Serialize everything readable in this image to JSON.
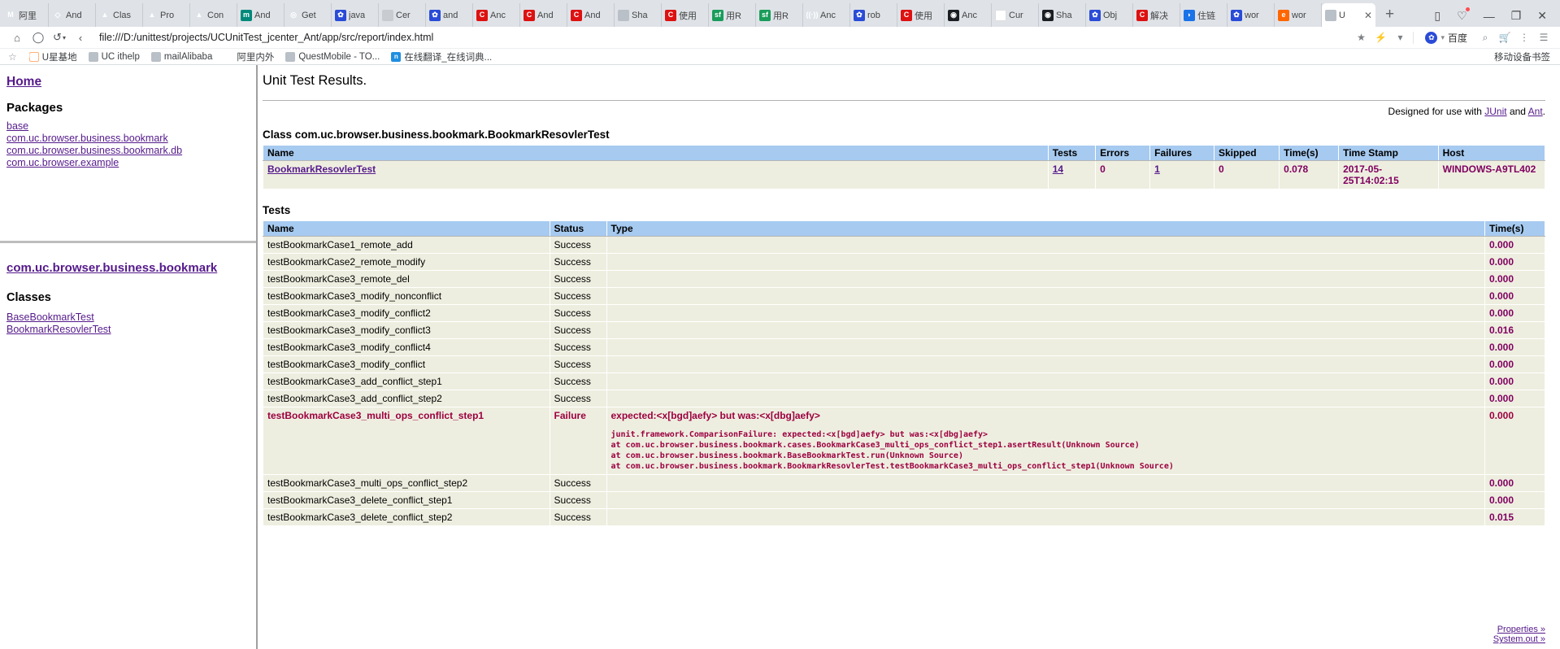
{
  "browser": {
    "tabs": [
      {
        "label": "阿里",
        "icon": "m-logo-icon",
        "style": "fav-m",
        "glyph": "M"
      },
      {
        "label": "And",
        "icon": "code-icon",
        "style": "fav-android",
        "glyph": "◇"
      },
      {
        "label": "Clas",
        "icon": "android-icon",
        "style": "fav-android",
        "glyph": "▲"
      },
      {
        "label": "Pro",
        "icon": "android-icon",
        "style": "fav-android",
        "glyph": "▲"
      },
      {
        "label": "Con",
        "icon": "android-icon",
        "style": "fav-android",
        "glyph": "▲"
      },
      {
        "label": "And",
        "icon": "maven-icon",
        "style": "fav-teal",
        "glyph": "m"
      },
      {
        "label": "Get",
        "icon": "gradle-icon",
        "style": "fav-get",
        "glyph": "◎"
      },
      {
        "label": "java",
        "icon": "baidu-paw-icon",
        "style": "fav-baidu",
        "glyph": "✿"
      },
      {
        "label": "Cer",
        "icon": "blank-page-icon",
        "style": "fav-plain",
        "glyph": ""
      },
      {
        "label": "and",
        "icon": "baidu-paw-icon",
        "style": "fav-baidu",
        "glyph": "✿"
      },
      {
        "label": "Anc",
        "icon": "csdn-icon",
        "style": "fav-c",
        "glyph": "C"
      },
      {
        "label": "And",
        "icon": "csdn-icon",
        "style": "fav-c",
        "glyph": "C"
      },
      {
        "label": "And",
        "icon": "csdn-icon",
        "style": "fav-c",
        "glyph": "C"
      },
      {
        "label": "Sha",
        "icon": "document-icon",
        "style": "fav-doc",
        "glyph": ""
      },
      {
        "label": "使用",
        "icon": "csdn-icon",
        "style": "fav-c",
        "glyph": "C"
      },
      {
        "label": "用R",
        "icon": "sf-icon",
        "style": "fav-sf",
        "glyph": "sf"
      },
      {
        "label": "用R",
        "icon": "sf-icon",
        "style": "fav-sf",
        "glyph": "sf"
      },
      {
        "label": "Anc",
        "icon": "wifi-icon",
        "style": "fav-wifi",
        "glyph": "((·))"
      },
      {
        "label": "rob",
        "icon": "baidu-paw-icon",
        "style": "fav-baidu",
        "glyph": "✿"
      },
      {
        "label": "使用",
        "icon": "csdn-icon",
        "style": "fav-c",
        "glyph": "C"
      },
      {
        "label": "Anc",
        "icon": "github-icon",
        "style": "fav-git",
        "glyph": "◉"
      },
      {
        "label": "Cur",
        "icon": "google-icon",
        "style": "fav-g",
        "glyph": "G"
      },
      {
        "label": "Sha",
        "icon": "github-icon",
        "style": "fav-git",
        "glyph": "◉"
      },
      {
        "label": "Obj",
        "icon": "baidu-paw-icon",
        "style": "fav-baidu",
        "glyph": "✿"
      },
      {
        "label": "解决",
        "icon": "csdn-icon",
        "style": "fav-c",
        "glyph": "C"
      },
      {
        "label": "住链",
        "icon": "blue-drop-icon",
        "style": "fav-blue",
        "glyph": "◗"
      },
      {
        "label": "wor",
        "icon": "baidu-paw-icon",
        "style": "fav-baidu",
        "glyph": "✿"
      },
      {
        "label": "wor",
        "icon": "alibaba-icon",
        "style": "fav-orange",
        "glyph": "e"
      }
    ],
    "active_tab": {
      "label": "U",
      "icon": "document-icon"
    },
    "new_tab_label": "+",
    "window_controls": {
      "sidebar": "▯",
      "notify": "♡",
      "minimize": "—",
      "maximize": "❐",
      "close": "✕"
    },
    "nav": {
      "home": "⌂",
      "reload": "◯",
      "history": "↺",
      "back": "‹",
      "url": "file:///D:/unittest/projects/UCUnitTest_jcenter_Ant/app/src/report/index.html",
      "bookmark_star": "★",
      "lightning": "⚡",
      "dropdown": "▾",
      "search_engine": "百度",
      "search_icon": "⌕",
      "cart_icon": "🛒",
      "more_icon": "⋮",
      "menu_icon": "☰"
    },
    "bookmarks": {
      "star": "☆",
      "items": [
        {
          "label": "U星基地",
          "icon": "uc-icon",
          "style": "bi-uc",
          "glyph": "UC"
        },
        {
          "label": "UC ithelp",
          "icon": "document-icon",
          "style": "bi-doc",
          "glyph": ""
        },
        {
          "label": "mailAlibaba",
          "icon": "document-icon",
          "style": "bi-doc",
          "glyph": ""
        },
        {
          "label": "阿里内外",
          "icon": "flower-icon",
          "style": "bi-fox",
          "glyph": "✿"
        },
        {
          "label": "QuestMobile - TO...",
          "icon": "document-icon",
          "style": "bi-doc",
          "glyph": ""
        },
        {
          "label": "在线翻译_在线词典...",
          "icon": "translate-icon",
          "style": "bi-trans",
          "glyph": "n"
        }
      ],
      "mobile_label": "移动设备书签",
      "mobile_icon": "mobile-icon"
    }
  },
  "sidebar": {
    "home_label": "Home",
    "packages_heading": "Packages",
    "packages": [
      "base",
      "com.uc.browser.business.bookmark",
      "com.uc.browser.business.bookmark.db",
      "com.uc.browser.example"
    ],
    "current_package": "com.uc.browser.business.bookmark",
    "classes_heading": "Classes",
    "classes": [
      "BaseBookmarkTest",
      "BookmarkResovlerTest"
    ]
  },
  "report": {
    "title": "Unit Test Results.",
    "designed_prefix": "Designed for use with ",
    "designed_junit": "JUnit",
    "designed_mid": " and ",
    "designed_ant": "Ant",
    "designed_suffix": ".",
    "class_heading": "Class com.uc.browser.business.bookmark.BookmarkResovlerTest",
    "summary_headers": [
      "Name",
      "Tests",
      "Errors",
      "Failures",
      "Skipped",
      "Time(s)",
      "Time Stamp",
      "Host"
    ],
    "summary_row": {
      "name": "BookmarkResovlerTest",
      "tests": "14",
      "errors": "0",
      "failures": "1",
      "skipped": "0",
      "time": "0.078",
      "timestamp": "2017-05-25T14:02:15",
      "host": "WINDOWS-A9TL402"
    },
    "tests_heading": "Tests",
    "tests_headers": [
      "Name",
      "Status",
      "Type",
      "Time(s)"
    ],
    "tests": [
      {
        "name": "testBookmarkCase1_remote_add",
        "status": "Success",
        "type": "",
        "time": "0.000",
        "failed": false
      },
      {
        "name": "testBookmarkCase2_remote_modify",
        "status": "Success",
        "type": "",
        "time": "0.000",
        "failed": false
      },
      {
        "name": "testBookmarkCase3_remote_del",
        "status": "Success",
        "type": "",
        "time": "0.000",
        "failed": false
      },
      {
        "name": "testBookmarkCase3_modify_nonconflict",
        "status": "Success",
        "type": "",
        "time": "0.000",
        "failed": false
      },
      {
        "name": "testBookmarkCase3_modify_conflict2",
        "status": "Success",
        "type": "",
        "time": "0.000",
        "failed": false
      },
      {
        "name": "testBookmarkCase3_modify_conflict3",
        "status": "Success",
        "type": "",
        "time": "0.016",
        "failed": false
      },
      {
        "name": "testBookmarkCase3_modify_conflict4",
        "status": "Success",
        "type": "",
        "time": "0.000",
        "failed": false
      },
      {
        "name": "testBookmarkCase3_modify_conflict",
        "status": "Success",
        "type": "",
        "time": "0.000",
        "failed": false
      },
      {
        "name": "testBookmarkCase3_add_conflict_step1",
        "status": "Success",
        "type": "",
        "time": "0.000",
        "failed": false
      },
      {
        "name": "testBookmarkCase3_add_conflict_step2",
        "status": "Success",
        "type": "",
        "time": "0.000",
        "failed": false
      },
      {
        "name": "testBookmarkCase3_multi_ops_conflict_step1",
        "status": "Failure",
        "type": "expected:<x[bgd]aefy> but was:<x[dbg]aefy>",
        "stack": "junit.framework.ComparisonFailure: expected:<x[bgd]aefy> but was:<x[dbg]aefy>\nat com.uc.browser.business.bookmark.cases.BookmarkCase3_multi_ops_conflict_step1.asertResult(Unknown Source)\nat com.uc.browser.business.bookmark.BaseBookmarkTest.run(Unknown Source)\nat com.uc.browser.business.bookmark.BookmarkResovlerTest.testBookmarkCase3_multi_ops_conflict_step1(Unknown Source)",
        "time": "0.000",
        "failed": true
      },
      {
        "name": "testBookmarkCase3_multi_ops_conflict_step2",
        "status": "Success",
        "type": "",
        "time": "0.000",
        "failed": false
      },
      {
        "name": "testBookmarkCase3_delete_conflict_step1",
        "status": "Success",
        "type": "",
        "time": "0.000",
        "failed": false
      },
      {
        "name": "testBookmarkCase3_delete_conflict_step2",
        "status": "Success",
        "type": "",
        "time": "0.015",
        "failed": false
      }
    ],
    "footer_links": [
      "Properties »",
      "System.out »"
    ]
  },
  "colors": {
    "table_header": "#a6caf0",
    "table_cell": "#eeeee0",
    "link": "#551a8b",
    "failure_text": "#9c0040",
    "value_text": "#800060"
  }
}
